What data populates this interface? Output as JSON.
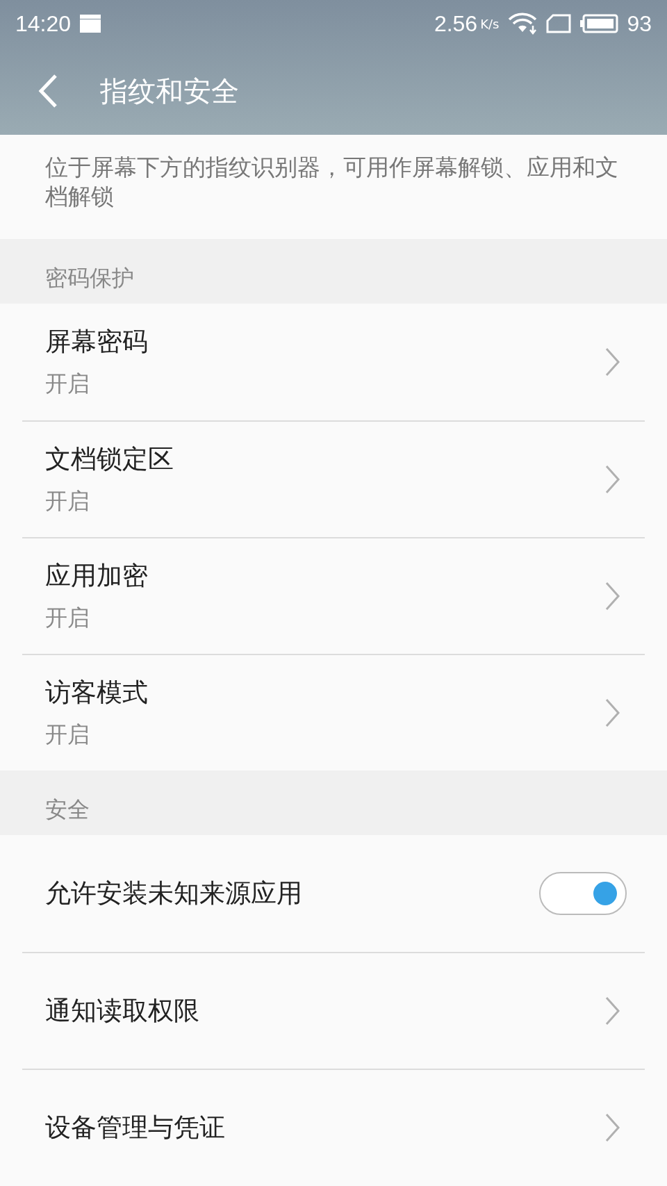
{
  "status_bar": {
    "time": "14:20",
    "speed": "2.56",
    "speed_unit": "K/s",
    "battery": "93"
  },
  "header": {
    "title": "指纹和安全"
  },
  "description": "位于屏幕下方的指纹识别器，可用作屏幕解锁、应用和文档解锁",
  "sections": [
    {
      "title": "密码保护",
      "items": [
        {
          "kind": "link",
          "label": "屏幕密码",
          "subtitle": "开启"
        },
        {
          "kind": "link",
          "label": "文档锁定区",
          "subtitle": "开启"
        },
        {
          "kind": "link",
          "label": "应用加密",
          "subtitle": "开启"
        },
        {
          "kind": "link",
          "label": "访客模式",
          "subtitle": "开启"
        }
      ]
    },
    {
      "title": "安全",
      "items": [
        {
          "kind": "toggle",
          "label": "允许安装未知来源应用",
          "on": true
        },
        {
          "kind": "link",
          "label": "通知读取权限"
        },
        {
          "kind": "link",
          "label": "设备管理与凭证"
        }
      ]
    }
  ]
}
